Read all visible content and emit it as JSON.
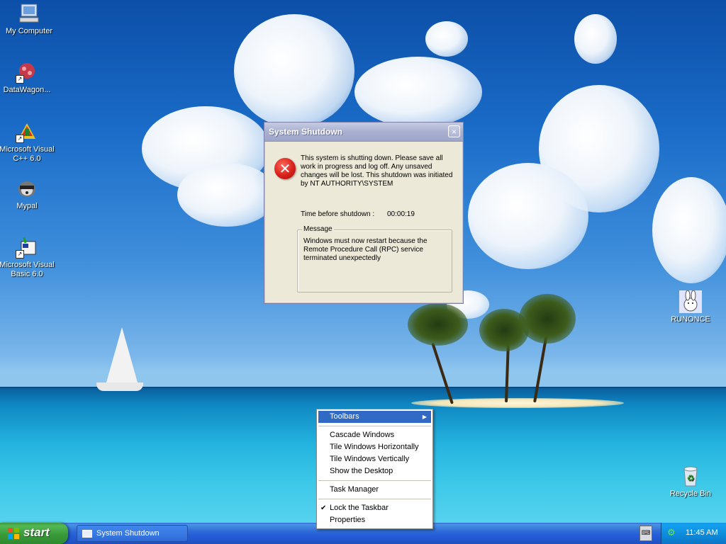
{
  "desktop": {
    "icons": [
      {
        "label": "My Computer",
        "icon": "my-computer-icon"
      },
      {
        "label": "DataWagon...",
        "icon": "datawagon-icon"
      },
      {
        "label": "Microsoft Visual C++ 6.0",
        "icon": "visual-cpp-icon"
      },
      {
        "label": "Mypal",
        "icon": "mypal-icon"
      },
      {
        "label": "Microsoft Visual Basic 6.0",
        "icon": "visual-basic-icon"
      },
      {
        "label": "RUNONCE",
        "icon": "runonce-icon"
      },
      {
        "label": "Recycle Bin",
        "icon": "recycle-bin-icon"
      }
    ]
  },
  "dialog": {
    "title": "System Shutdown",
    "close_glyph": "×",
    "icon": "error-icon",
    "body": "This system is shutting down. Please save all work in progress and log off. Any unsaved changes will be lost. This shutdown was initiated by NT AUTHORITY\\SYSTEM",
    "time_label": "Time before shutdown :",
    "time_value": "00:00:19",
    "message_legend": "Message",
    "message_text": "Windows must now restart because the Remote Procedure Call (RPC) service terminated unexpectedly"
  },
  "context_menu": {
    "items": [
      {
        "label": "Toolbars",
        "submenu": true,
        "highlighted": true
      },
      {
        "label": "Cascade Windows"
      },
      {
        "label": "Tile Windows Horizontally"
      },
      {
        "label": "Tile Windows Vertically"
      },
      {
        "label": "Show the Desktop"
      },
      {
        "label": "Task Manager"
      },
      {
        "label": "Lock the Taskbar",
        "checked": true
      },
      {
        "label": "Properties"
      }
    ]
  },
  "taskbar": {
    "start_label": "start",
    "task_buttons": [
      {
        "label": "System Shutdown"
      }
    ],
    "clock": "11:45 AM"
  },
  "colors": {
    "taskbar_blue": "#245edb",
    "start_green": "#3a9a3a",
    "menu_highlight": "#316ac5",
    "dialog_bg": "#ece9d8"
  }
}
